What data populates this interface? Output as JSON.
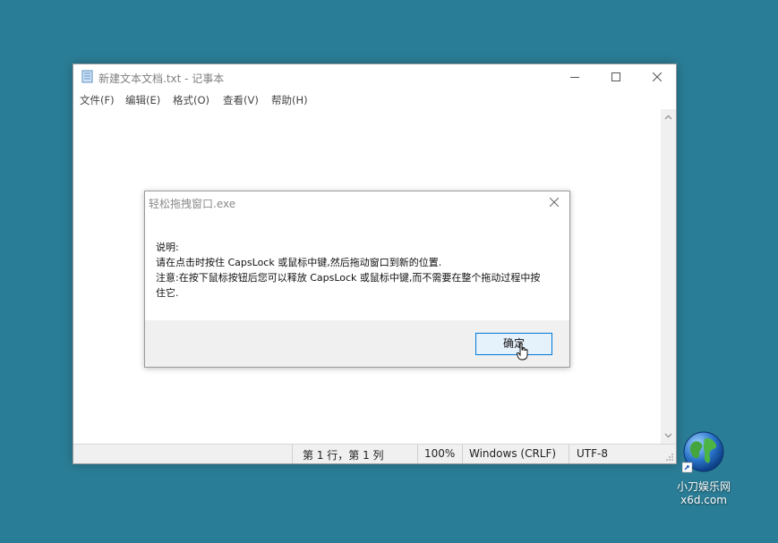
{
  "notepad": {
    "title": "新建文本文档.txt - 记事本",
    "menu": [
      "文件(F)",
      "编辑(E)",
      "格式(O)",
      "查看(V)",
      "帮助(H)"
    ],
    "status": {
      "position": "第 1 行，第 1 列",
      "zoom": "100%",
      "line_ending": "Windows (CRLF)",
      "encoding": "UTF-8"
    }
  },
  "dialog": {
    "title": "轻松拖拽窗口.exe",
    "lines": [
      "说明:",
      "请在点击时按住 CapsLock 或鼠标中键,然后拖动窗口到新的位置.",
      "注意:在按下鼠标按钮后您可以释放 CapsLock 或鼠标中键,而不需要在整个拖动过程中按",
      "住它."
    ],
    "ok_label": "确定"
  },
  "desktop": {
    "icon_label": "小刀娱乐网",
    "icon_sub": "x6d.com"
  },
  "colors": {
    "desktop_bg": "#2a7d96",
    "accent": "#0078d7"
  }
}
